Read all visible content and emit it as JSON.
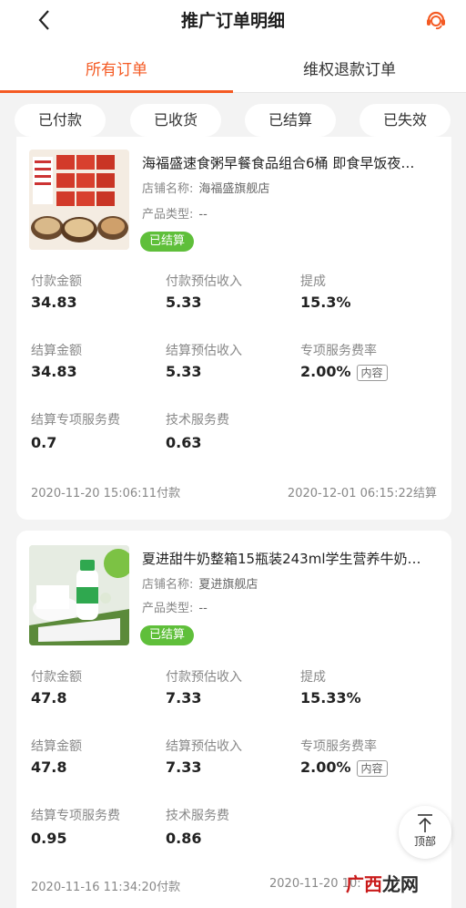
{
  "header": {
    "title": "推广订单明细",
    "back_icon": "chevron-left-icon",
    "service_icon": "customer-service-icon"
  },
  "tabs": [
    {
      "label": "所有订单",
      "active": true
    },
    {
      "label": "维权退款订单",
      "active": false
    }
  ],
  "filters": [
    "已付款",
    "已收货",
    "已结算",
    "已失效"
  ],
  "labels": {
    "shop": "店铺名称:",
    "type": "产品类型:",
    "pay_amount": "付款金额",
    "pay_est": "付款预估收入",
    "commission": "提成",
    "settle_amount": "结算金额",
    "settle_est": "结算预估收入",
    "service_rate": "专项服务费率",
    "settle_service_fee": "结算专项服务费",
    "tech_fee": "技术服务费",
    "badge": "内容"
  },
  "orders": [
    {
      "product_name": "海福盛速食粥早餐食品组合6桶 即食早饭夜…",
      "shop": "海福盛旗舰店",
      "type": "--",
      "status": "已结算",
      "pay_amount": "34.83",
      "pay_est": "5.33",
      "commission": "15.3%",
      "settle_amount": "34.83",
      "settle_est": "5.33",
      "service_rate": "2.00%",
      "settle_service_fee": "0.7",
      "tech_fee": "0.63",
      "pay_time": "2020-11-20 15:06:11付款",
      "settle_time": "2020-12-01 06:15:22结算"
    },
    {
      "product_name": "夏进甜牛奶整箱15瓶装243ml学生营养牛奶…",
      "shop": "夏进旗舰店",
      "type": "--",
      "status": "已结算",
      "pay_amount": "47.8",
      "pay_est": "7.33",
      "commission": "15.33%",
      "settle_amount": "47.8",
      "settle_est": "7.33",
      "service_rate": "2.00%",
      "settle_service_fee": "0.95",
      "tech_fee": "0.86",
      "pay_time": "2020-11-16 11:34:20付款",
      "settle_time": "2020-11-20 10:"
    }
  ],
  "back_to_top": "顶部",
  "watermark": {
    "part1": "广西",
    "part2": "龙网"
  },
  "colors": {
    "accent": "#f45a23",
    "status_green": "#5fbf3a"
  }
}
